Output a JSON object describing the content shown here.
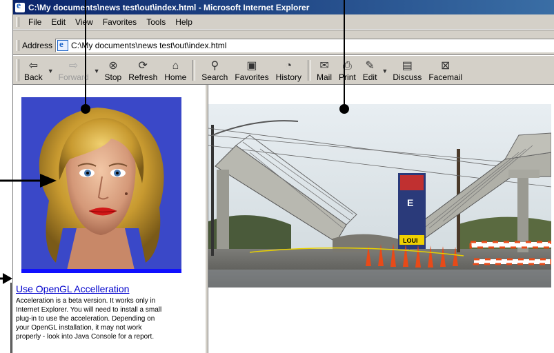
{
  "window": {
    "title": "C:\\My documents\\news test\\out\\index.html - Microsoft Internet Explorer"
  },
  "menu": {
    "items": [
      {
        "label": "File",
        "name": "file"
      },
      {
        "label": "Edit",
        "name": "edit"
      },
      {
        "label": "View",
        "name": "view"
      },
      {
        "label": "Favorites",
        "name": "favorites"
      },
      {
        "label": "Tools",
        "name": "tools"
      },
      {
        "label": "Help",
        "name": "help"
      }
    ]
  },
  "address": {
    "label": "Address",
    "value": "C:\\My documents\\news test\\out\\index.html"
  },
  "toolbar": {
    "back": "Back",
    "forward": "Forward",
    "stop": "Stop",
    "refresh": "Refresh",
    "home": "Home",
    "search": "Search",
    "favorites": "Favorites",
    "history": "History",
    "mail": "Mail",
    "print": "Print",
    "edit": "Edit",
    "discuss": "Discuss",
    "facemail": "Facemail"
  },
  "left_frame": {
    "link_label": "Use OpenGL Accelleration",
    "description_lines": [
      "Acceleration is a beta version. It works only in",
      "Internet Explorer. You will need to install a small",
      "plug-in to use the acceleration. Depending on",
      "your OpenGL installation, it may not work",
      "properly - look into Java Console for a report."
    ]
  },
  "right_frame": {
    "sign_letters": "E",
    "sign_bottom": "LOUI"
  },
  "colors": {
    "titlebar_start": "#0a246a",
    "titlebar_end": "#3a6ea5",
    "link": "#0000cc",
    "chrome": "#d4d0c8",
    "avatar_bg": "#3040c0"
  }
}
